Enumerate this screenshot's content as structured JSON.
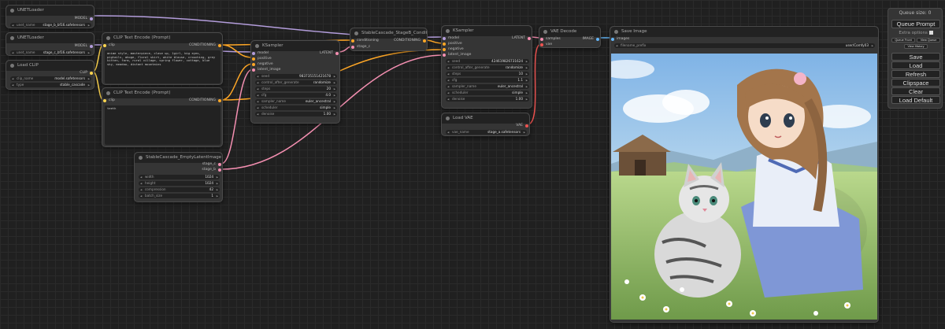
{
  "nodes": {
    "unet_b": {
      "title": "UNETLoader",
      "out_model": "MODEL",
      "w_unet_name_label": "unet_name",
      "w_unet_name_value": "stage_b_bf16.safetensors"
    },
    "unet_c": {
      "title": "UNETLoader",
      "out_model": "MODEL",
      "w_unet_name_label": "unet_name",
      "w_unet_name_value": "stage_c_bf16.safetensors"
    },
    "clip_loader": {
      "title": "Load CLIP",
      "out_clip": "CLIP",
      "w_clip_name_label": "clip_name",
      "w_clip_name_value": "model.safetensors",
      "w_type_label": "type",
      "w_type_value": "stable_cascade"
    },
    "clip_pos": {
      "title": "CLIP Text Encode (Prompt)",
      "in_clip": "clip",
      "out_cond": "CONDITIONING",
      "text": "anime style, masterpiece, close up, 1girl, big eyes, pigtails, ahoge, floral skirt, white blouse, crouching, grey kitten, farm, rural village, spring flower, cottage, blue sky, meadow, distant mountains"
    },
    "clip_neg": {
      "title": "CLIP Text Encode (Prompt)",
      "in_clip": "clip",
      "out_cond": "CONDITIONING",
      "text": "teeth"
    },
    "ksampler_1": {
      "title": "KSampler",
      "in_model": "model",
      "in_positive": "positive",
      "in_negative": "negative",
      "in_latent": "latent_image",
      "out_latent": "LATENT",
      "widgets": [
        {
          "label": "seed",
          "value": "983735151421678"
        },
        {
          "label": "control_after_generate",
          "value": "randomize"
        },
        {
          "label": "steps",
          "value": "20"
        },
        {
          "label": "cfg",
          "value": "4.0"
        },
        {
          "label": "sampler_name",
          "value": "euler_ancestral"
        },
        {
          "label": "scheduler",
          "value": "simple"
        },
        {
          "label": "denoise",
          "value": "1.00"
        }
      ]
    },
    "empty_latent": {
      "title": "StableCascade_EmptyLatentImage",
      "out_stage_c": "stage_c",
      "out_stage_b": "stage_b",
      "widgets": [
        {
          "label": "width",
          "value": "1024"
        },
        {
          "label": "height",
          "value": "1024"
        },
        {
          "label": "compression",
          "value": "42"
        },
        {
          "label": "batch_size",
          "value": "1"
        }
      ]
    },
    "conditioning": {
      "title": "StableCascade_StageB_Conditioning",
      "in_cond": "conditioning",
      "in_stage_c": "stage_c",
      "out_cond": "CONDITIONING"
    },
    "ksampler_2": {
      "title": "KSampler",
      "in_model": "model",
      "in_positive": "positive",
      "in_negative": "negative",
      "in_latent": "latent_image",
      "out_latent": "LATENT",
      "widgets": [
        {
          "label": "seed",
          "value": "424619826731624"
        },
        {
          "label": "control_after_generate",
          "value": "randomize"
        },
        {
          "label": "steps",
          "value": "10"
        },
        {
          "label": "cfg",
          "value": "1.1"
        },
        {
          "label": "sampler_name",
          "value": "euler_ancestral"
        },
        {
          "label": "scheduler",
          "value": "simple"
        },
        {
          "label": "denoise",
          "value": "1.00"
        }
      ]
    },
    "load_vae": {
      "title": "Load VAE",
      "out_vae": "VAE",
      "w_vae_name_label": "vae_name",
      "w_vae_name_value": "stage_a.safetensors"
    },
    "vae_decode": {
      "title": "VAE Decode",
      "in_samples": "samples",
      "in_vae": "vae",
      "out_image": "IMAGE"
    },
    "save_image": {
      "title": "Save Image",
      "in_images": "images",
      "w_prefix_label": "filename_prefix",
      "w_prefix_value": "user/Comfy03"
    }
  },
  "queue_panel": {
    "title": "Queue size: 0",
    "queue_prompt": "Queue Prompt",
    "extra_options": "Extra options",
    "queue_front": "Queue Front",
    "view_queue": "View Queue",
    "view_history": "View History",
    "save": "Save",
    "load": "Load",
    "refresh": "Refresh",
    "clipspace": "Clipspace",
    "clear": "Clear",
    "load_default": "Load Default"
  },
  "colors": {
    "model": "#b39ddb",
    "clip": "#ffd54f",
    "conditioning": "#ffa726",
    "latent": "#f48fb1",
    "vae": "#ef5350",
    "image": "#64b5f6"
  }
}
